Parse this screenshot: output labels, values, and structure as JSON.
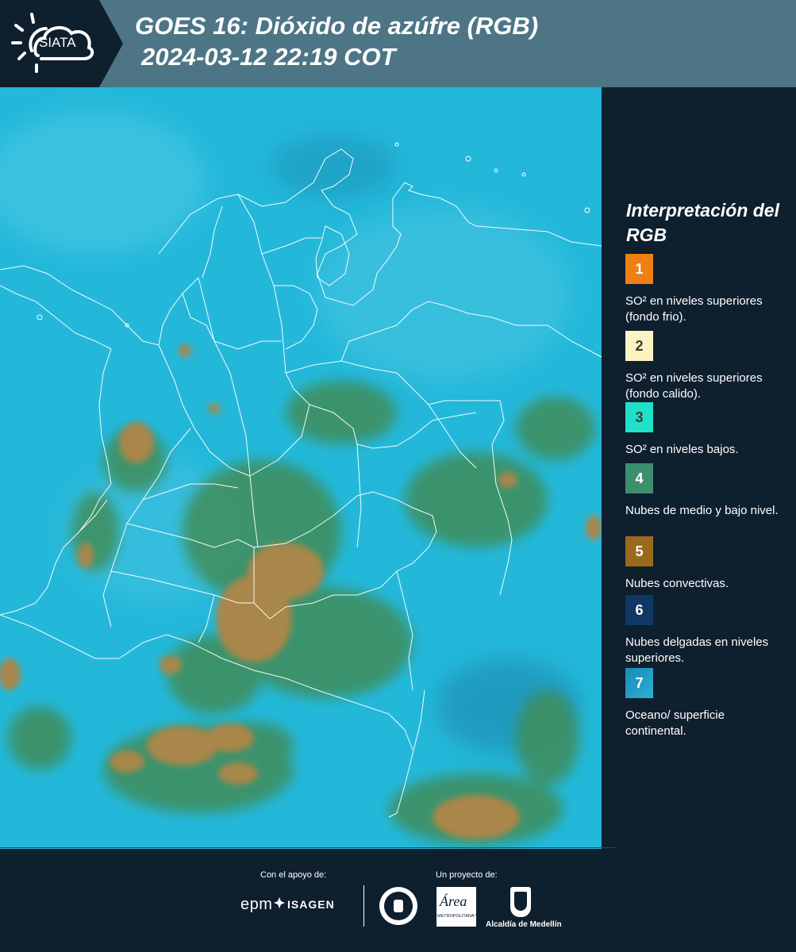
{
  "header": {
    "logo_text": "SIATA",
    "title_line1": "GOES 16: Dióxido de azúfre (RGB)",
    "title_line2": "2024-03-12 22:19 COT"
  },
  "legend": {
    "title": "Interpretación del RGB",
    "items": [
      {
        "number": "1",
        "color": "#f07f12",
        "text_color": "#ffffff",
        "label": "SO² en niveles superiores (fondo frio)."
      },
      {
        "number": "2",
        "color": "#fbf3c2",
        "text_color": "#3a3a3a",
        "label": "SO² en niveles superiores (fondo calido)."
      },
      {
        "number": "3",
        "color": "#1fe1c9",
        "text_color": "#3a3a3a",
        "label": "SO² en niveles bajos."
      },
      {
        "number": "4",
        "color": "#3b8f6e",
        "text_color": "#ffffff",
        "label": "Nubes de medio y bajo nivel."
      },
      {
        "number": "5",
        "color": "#9a6a1c",
        "text_color": "#ffffff",
        "label": "Nubes convectivas."
      },
      {
        "number": "6",
        "color": "#0f3866",
        "text_color": "#ffffff",
        "label": "Nubes delgadas en niveles superiores."
      },
      {
        "number": "7",
        "color": "#1c8ab3",
        "text_color": "#ffffff",
        "label": "Oceano/ superficie continental."
      }
    ]
  },
  "footer": {
    "support_label": "Con el apoyo de:",
    "project_label": "Un proyecto de:",
    "sponsor1": "epm",
    "sponsor2": "ISAGEN",
    "area_name": "Área",
    "area_subtitle": "METROPOLITANA Valle de Aburrá",
    "partner2": "Alcaldía de Medellín"
  },
  "map": {
    "ocean_color": "#22b7d9",
    "convective_color": "#a9864a",
    "mid_cloud_color": "#3f8a55",
    "border_color": "#ffffff"
  }
}
